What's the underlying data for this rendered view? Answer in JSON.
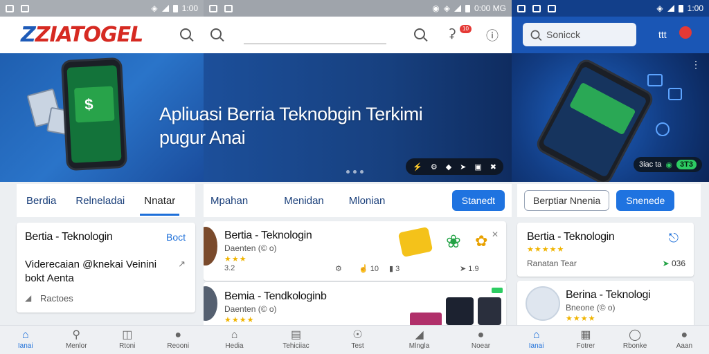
{
  "screen1": {
    "status_time": "1:00",
    "logo": "ZIATOGEL",
    "hero_title_line1": "Apliuasi Berria Teknobgin Terkimi",
    "hero_title_line2": "pugur Anai",
    "tabs": [
      {
        "label": "Berdia",
        "active": false
      },
      {
        "label": "Relneladai",
        "active": false
      },
      {
        "label": "Nnatar",
        "active": true
      }
    ],
    "card": {
      "title": "Bertia - Teknologin",
      "action": "Boct",
      "body_line1": "Viderecaian @knekai Veinini",
      "body_line2": "bokt Aenta",
      "footer": "Ractoes"
    },
    "nav": [
      {
        "label": "Ianai",
        "icon": "home-icon",
        "active": true
      },
      {
        "label": "Menlor",
        "icon": "search-icon",
        "active": false
      },
      {
        "label": "Rtoni",
        "icon": "inbox-icon",
        "active": false
      },
      {
        "label": "Reooni",
        "icon": "person-icon",
        "active": false
      }
    ]
  },
  "screen2": {
    "status_time": "0:00 MG",
    "search_value": "",
    "badge": "10",
    "tabs": [
      {
        "label": "Mpahan",
        "active": false
      },
      {
        "label": "Menidan",
        "active": false
      },
      {
        "label": "Mlonian",
        "active": false
      }
    ],
    "button": "Stanedt",
    "cards": [
      {
        "title": "Bertia - Teknologin",
        "sub": "Daenten (© o)",
        "rating": "3.2",
        "stats": [
          "10",
          "3",
          "1.9"
        ]
      },
      {
        "title": "Bemia - Tendkologinb",
        "sub": "Daenten (© o)",
        "rating": "4.0",
        "stats": []
      }
    ],
    "nav": [
      {
        "label": "Hedia",
        "icon": "home-icon",
        "active": false
      },
      {
        "label": "Tehiciiac",
        "icon": "document-icon",
        "active": false
      },
      {
        "label": "Test",
        "icon": "compass-icon",
        "active": false
      },
      {
        "label": "Mlngla",
        "icon": "tag-icon",
        "active": false
      },
      {
        "label": "Noear",
        "icon": "person-icon",
        "active": false
      }
    ]
  },
  "screen3": {
    "status_time": "1:00",
    "search_placeholder": "Sonicck",
    "header_label": "ttt",
    "hero_chip_text": "3iac ta",
    "hero_chip_value": "3T3",
    "buttons": {
      "outline": "Berptiar Nnenia",
      "primary": "Snenede"
    },
    "cards": [
      {
        "title": "Bertia - Teknologin",
        "sub": "Ranatan Tear",
        "stat": "036"
      },
      {
        "title": "Berina - Teknologi",
        "sub": "Bneone (© o)",
        "stat": ""
      }
    ],
    "nav": [
      {
        "label": "Ianai",
        "icon": "home-icon",
        "active": true
      },
      {
        "label": "Fotrer",
        "icon": "grid-icon",
        "active": false
      },
      {
        "label": "Rbonke",
        "icon": "shield-icon",
        "active": false
      },
      {
        "label": "Aaan",
        "icon": "person-icon",
        "active": false
      }
    ]
  },
  "colors": {
    "accent": "#1d6fd9",
    "brand_red": "#d62a22",
    "brand_blue": "#1e5bb8",
    "star": "#f0b400"
  }
}
